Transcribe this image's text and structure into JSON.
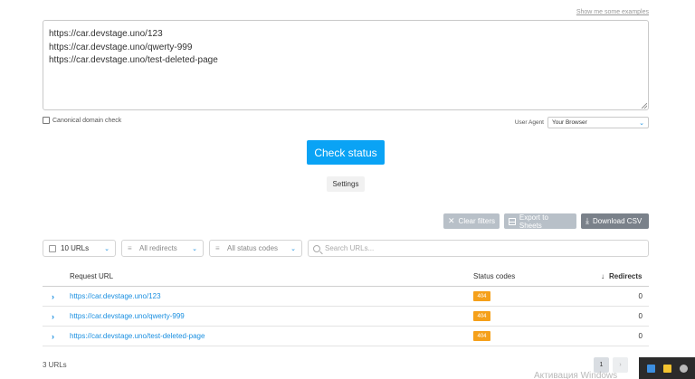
{
  "examples_link": "Show me some examples",
  "urls_text": "https://car.devstage.uno/123\nhttps://car.devstage.uno/qwerty-999\nhttps://car.devstage.uno/test-deleted-page",
  "canonical_label": "Canonical domain check",
  "user_agent": {
    "label": "User Agent",
    "value": "Your Browser"
  },
  "check_button": "Check status",
  "settings_button": "Settings",
  "toolbar": {
    "clear_filters": "Clear filters",
    "export_sheets": "Export to Sheets",
    "download_csv": "Download CSV"
  },
  "filters": {
    "count": "10 URLs",
    "redirects": "All redirects",
    "status_codes": "All status codes",
    "search_placeholder": "Search URLs..."
  },
  "table": {
    "headers": {
      "url": "Request URL",
      "status": "Status codes",
      "redirects": "Redirects"
    },
    "rows": [
      {
        "url": "https://car.devstage.uno/123",
        "status": "404",
        "redirects": "0"
      },
      {
        "url": "https://car.devstage.uno/qwerty-999",
        "status": "404",
        "redirects": "0"
      },
      {
        "url": "https://car.devstage.uno/test-deleted-page",
        "status": "404",
        "redirects": "0"
      }
    ]
  },
  "total": "3 URLs",
  "pagination": {
    "current": "1",
    "next": "›"
  },
  "watermark": "Активация Windows",
  "colors": {
    "primary": "#0aa3f5",
    "link": "#1a8fe0",
    "badge": "#f5a01a",
    "csv_button": "#7a818a"
  }
}
